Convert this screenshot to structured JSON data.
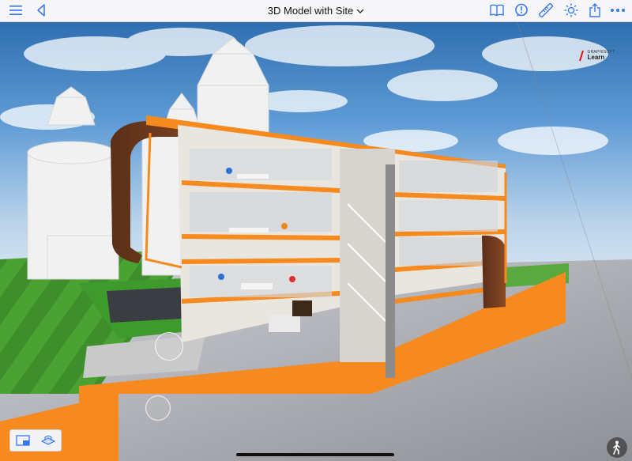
{
  "header": {
    "title": "3D Model with Site"
  },
  "logo": {
    "brand_small": "GRAPHISOFT",
    "brand_big": "Learn"
  },
  "icons": {
    "menu": "menu-icon",
    "back": "back-icon",
    "book": "book-icon",
    "alert": "alert-icon",
    "ruler": "ruler-icon",
    "sun": "sun-icon",
    "share": "share-icon",
    "more": "more-icon"
  },
  "colors": {
    "accent": "#3478f6",
    "building_accent": "#f68a1e"
  }
}
